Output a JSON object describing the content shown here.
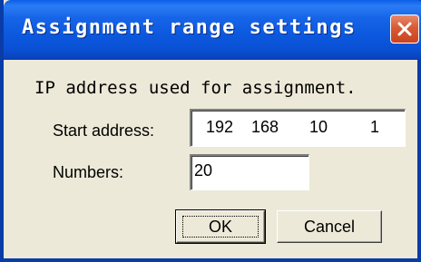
{
  "dialog": {
    "title": "Assignment range settings",
    "description": "IP address used for assignment."
  },
  "start_address": {
    "label": "Start address:",
    "octets": [
      "192",
      "168",
      "10",
      "1"
    ]
  },
  "numbers": {
    "label": "Numbers:",
    "value": "20"
  },
  "buttons": {
    "ok": "OK",
    "cancel": "Cancel"
  },
  "colors": {
    "titlebar": "#0b58de",
    "close_button": "#d95a34",
    "dialog_background": "#ece9d8"
  }
}
